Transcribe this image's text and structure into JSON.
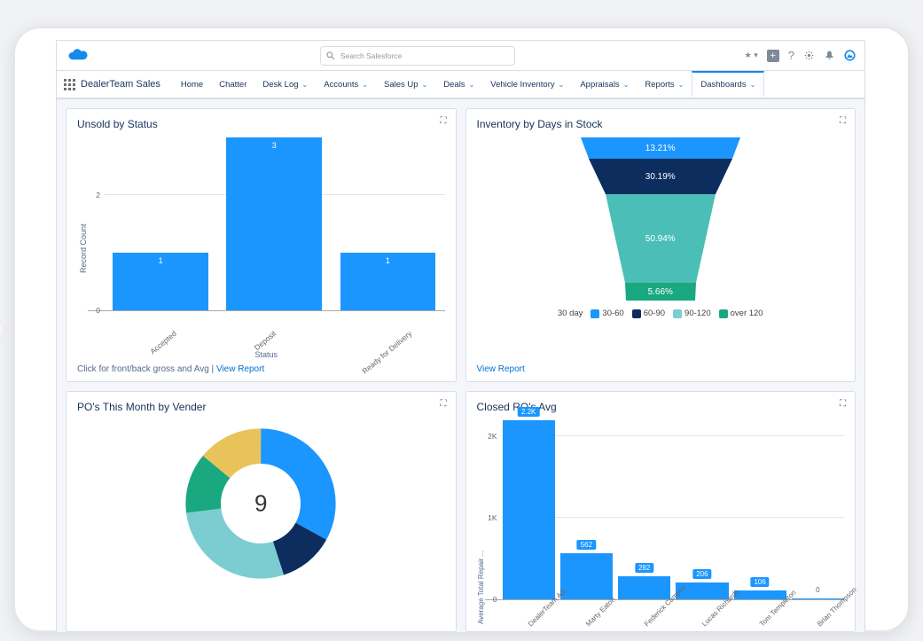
{
  "header": {
    "search_placeholder": "Search Salesforce"
  },
  "nav": {
    "app_name": "DealerTeam Sales",
    "items": [
      {
        "label": "Home",
        "has_dropdown": false
      },
      {
        "label": "Chatter",
        "has_dropdown": false
      },
      {
        "label": "Desk Log",
        "has_dropdown": true
      },
      {
        "label": "Accounts",
        "has_dropdown": true
      },
      {
        "label": "Sales Up",
        "has_dropdown": true
      },
      {
        "label": "Deals",
        "has_dropdown": true
      },
      {
        "label": "Vehicle Inventory",
        "has_dropdown": true
      },
      {
        "label": "Appraisals",
        "has_dropdown": true
      },
      {
        "label": "Reports",
        "has_dropdown": true
      },
      {
        "label": "Dashboards",
        "has_dropdown": true,
        "active": true
      }
    ]
  },
  "cards": {
    "unsold": {
      "title": "Unsold by Status",
      "y_label": "Record Count",
      "x_label": "Status",
      "footer_prefix": "Click for front/back gross and Avg | ",
      "footer_link": "View Report"
    },
    "inventory": {
      "title": "Inventory by Days in Stock",
      "legend_first": "30 day",
      "legend": [
        "30-60",
        "60-90",
        "90-120",
        "over 120"
      ],
      "footer_link": "View Report"
    },
    "po": {
      "title": "PO's This Month by Vender",
      "center_value": "9"
    },
    "ro": {
      "title": "Closed RO's Avg",
      "y_label": "Average Total Repair ..."
    }
  },
  "chart_data": [
    {
      "id": "unsold",
      "type": "bar",
      "title": "Unsold by Status",
      "xlabel": "Status",
      "ylabel": "Record Count",
      "ylim": [
        0,
        3
      ],
      "yticks": [
        0,
        2
      ],
      "categories": [
        "Accepted",
        "Deposit",
        "Ready for Delivery"
      ],
      "values": [
        1,
        3,
        1
      ]
    },
    {
      "id": "inventory",
      "type": "funnel",
      "title": "Inventory by Days in Stock",
      "categories": [
        "30 day",
        "30-60",
        "60-90",
        "90-120",
        "over 120"
      ],
      "values_pct": [
        null,
        13.21,
        30.19,
        50.94,
        5.66
      ],
      "colors": [
        "",
        "#1b96ff",
        "#0d2d5e",
        "#4bbfb7",
        "#1aa880"
      ]
    },
    {
      "id": "po",
      "type": "pie",
      "title": "PO's This Month by Vender",
      "total": 9,
      "slices": [
        {
          "color": "#1b96ff",
          "pct": 33
        },
        {
          "color": "#0d2d5e",
          "pct": 12
        },
        {
          "color": "#7bcdd1",
          "pct": 28
        },
        {
          "color": "#1aa880",
          "pct": 13
        },
        {
          "color": "#e8c35a",
          "pct": 14
        }
      ]
    },
    {
      "id": "ro",
      "type": "bar",
      "title": "Closed RO's Avg",
      "ylabel": "Average Total Repair ...",
      "ylim": [
        0,
        2200
      ],
      "yticks": [
        0,
        1000,
        2000
      ],
      "ytick_labels": [
        "0",
        "1K",
        "2K"
      ],
      "categories": [
        "DealerTeam Ad...",
        "Marty Eaton",
        "Federick Campos",
        "Lucas Richards",
        "Tom Templeton",
        "Brian Thompson"
      ],
      "values": [
        2200,
        562,
        282,
        206,
        106,
        0
      ],
      "value_labels": [
        "2.2K",
        "562",
        "282",
        "206",
        "106",
        "0"
      ]
    }
  ]
}
